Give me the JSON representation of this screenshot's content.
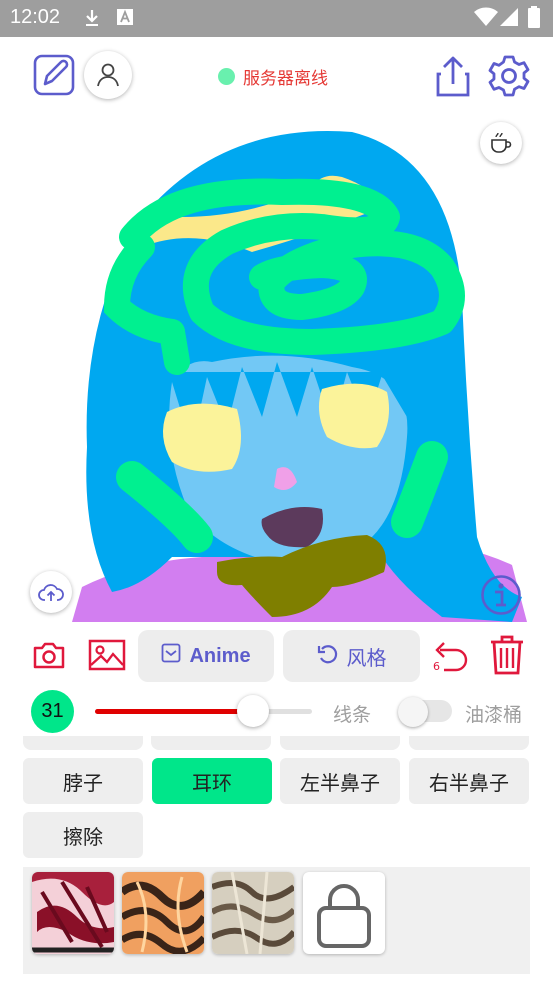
{
  "status_bar": {
    "time": "12:02",
    "icons": [
      "download-icon",
      "font-app-icon",
      "wifi-icon",
      "cell-signal-icon",
      "battery-icon"
    ]
  },
  "header": {
    "left_icons": [
      "edit-pen-icon",
      "user-icon"
    ],
    "server_status": "服务器离线",
    "server_status_color": "#e53935",
    "server_dot_color": "#69f0ae",
    "right_icons": [
      "share-upload-icon",
      "gear-icon"
    ]
  },
  "canvas": {
    "floating_buttons": [
      "coffee-icon",
      "cloud-upload-icon",
      "info-icon"
    ]
  },
  "toolbar": {
    "camera_icon": "camera-icon",
    "gallery_icon": "image-gallery-icon",
    "anime_label": "Anime",
    "style_label": "风格",
    "undo_count": "6",
    "delete_icon": "trash-icon",
    "accent_color": "#e0183c",
    "pill_text_color": "#5c5ccc"
  },
  "brush": {
    "size": "31",
    "size_fraction": 0.73,
    "mode_label": "线条",
    "bucket_label": "油漆桶",
    "bucket_enabled": false
  },
  "tags": [
    {
      "label": "脖子",
      "active": false
    },
    {
      "label": "耳环",
      "active": true
    },
    {
      "label": "左半鼻子",
      "active": false
    },
    {
      "label": "右半鼻子",
      "active": false
    },
    {
      "label": "擦除",
      "active": false
    }
  ],
  "style_thumbs": [
    "style-thumb-red",
    "style-thumb-orange",
    "style-thumb-beige",
    "lock-icon"
  ]
}
